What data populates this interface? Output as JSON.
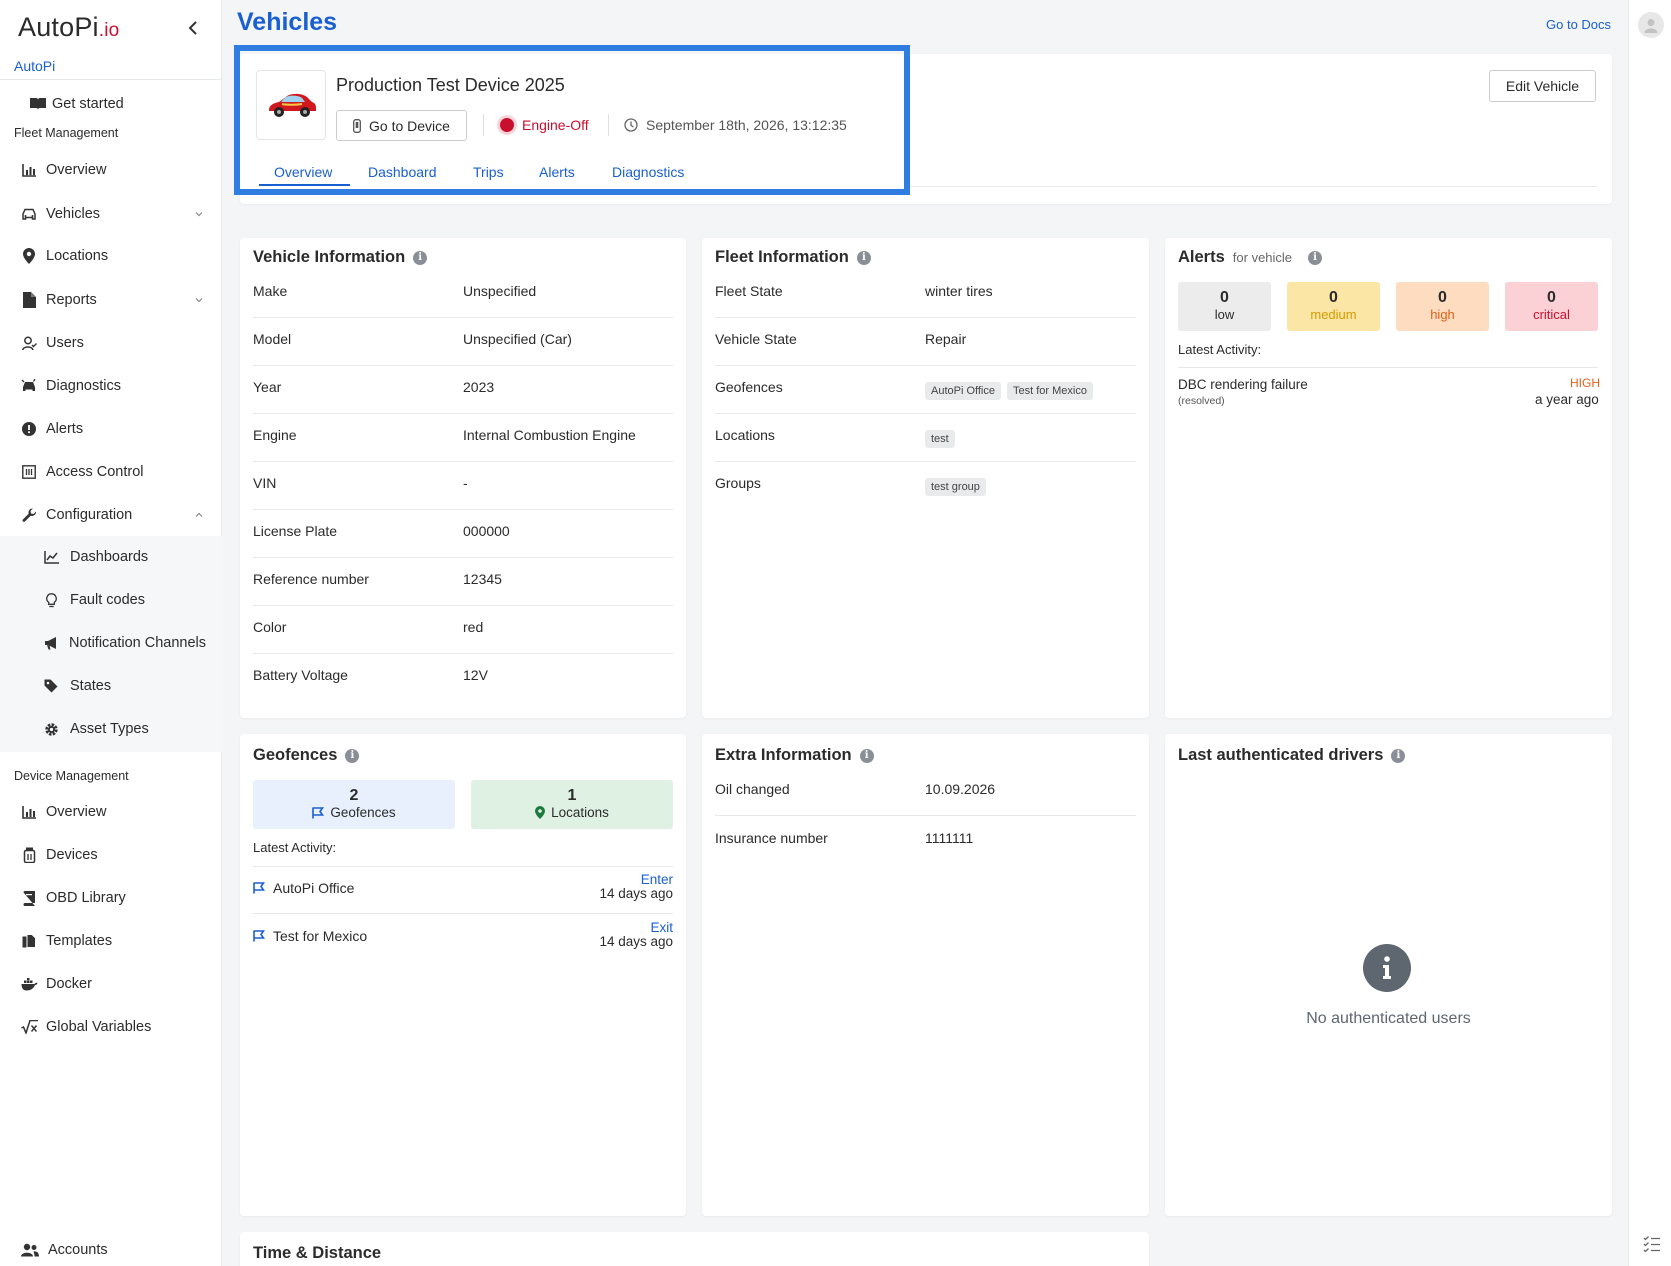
{
  "sidebar": {
    "logo_main": "AutoPi",
    "logo_suffix": ".io",
    "org": "AutoPi",
    "get_started": "Get started",
    "fleet_section": "Fleet Management",
    "fleet_items": [
      "Overview",
      "Vehicles",
      "Locations",
      "Reports",
      "Users",
      "Diagnostics",
      "Alerts",
      "Access Control",
      "Configuration"
    ],
    "config_items": [
      "Dashboards",
      "Fault codes",
      "Notification Channels",
      "States",
      "Asset Types"
    ],
    "device_section": "Device Management",
    "device_items": [
      "Overview",
      "Devices",
      "OBD Library",
      "Templates",
      "Docker",
      "Global Variables"
    ],
    "accounts": "Accounts"
  },
  "header": {
    "title": "Vehicles",
    "docs_link": "Go to Docs"
  },
  "vehicle": {
    "name": "Production Test Device 2025",
    "goto_device": "Go to Device",
    "engine_state": "Engine-Off",
    "timestamp": "September 18th, 2026, 13:12:35",
    "edit_button": "Edit Vehicle",
    "tabs": [
      "Overview",
      "Dashboard",
      "Trips",
      "Alerts",
      "Diagnostics"
    ],
    "active_tab": "Overview"
  },
  "vehicle_info": {
    "title": "Vehicle Information",
    "rows": [
      {
        "k": "Make",
        "v": "Unspecified"
      },
      {
        "k": "Model",
        "v": "Unspecified (Car)"
      },
      {
        "k": "Year",
        "v": "2023"
      },
      {
        "k": "Engine",
        "v": "Internal Combustion Engine"
      },
      {
        "k": "VIN",
        "v": "-"
      },
      {
        "k": "License Plate",
        "v": "000000"
      },
      {
        "k": "Reference number",
        "v": "12345"
      },
      {
        "k": "Color",
        "v": "red"
      },
      {
        "k": "Battery Voltage",
        "v": "12V"
      }
    ]
  },
  "fleet_info": {
    "title": "Fleet Information",
    "fleet_state_label": "Fleet State",
    "fleet_state": "winter tires",
    "vehicle_state_label": "Vehicle State",
    "vehicle_state": "Repair",
    "geofences_label": "Geofences",
    "geofences": [
      "AutoPi Office",
      "Test for Mexico"
    ],
    "locations_label": "Locations",
    "locations": [
      "test"
    ],
    "groups_label": "Groups",
    "groups": [
      "test group"
    ]
  },
  "alerts": {
    "title": "Alerts",
    "subtitle": "for vehicle",
    "counts": [
      {
        "n": "0",
        "t": "low",
        "bg": "#ececec",
        "fg": "#2b2b2b"
      },
      {
        "n": "0",
        "t": "medium",
        "bg": "#fbe6a5",
        "fg": "#d69a00"
      },
      {
        "n": "0",
        "t": "high",
        "bg": "#fddcc0",
        "fg": "#e0601a"
      },
      {
        "n": "0",
        "t": "critical",
        "bg": "#fbd1d6",
        "fg": "#c8102e"
      }
    ],
    "latest_label": "Latest Activity:",
    "activity": {
      "name": "DBC rendering failure",
      "status": "(resolved)",
      "level": "HIGH",
      "age": "a year ago"
    }
  },
  "geofences": {
    "title": "Geofences",
    "geofence_count": "2",
    "geofence_label": "Geofences",
    "location_count": "1",
    "location_label": "Locations",
    "latest_label": "Latest Activity:",
    "activity": [
      {
        "name": "AutoPi Office",
        "event": "Enter",
        "age": "14 days ago"
      },
      {
        "name": "Test for Mexico",
        "event": "Exit",
        "age": "14 days ago"
      }
    ]
  },
  "extra_info": {
    "title": "Extra Information",
    "rows": [
      {
        "k": "Oil changed",
        "v": "10.09.2026"
      },
      {
        "k": "Insurance number",
        "v": "1111111"
      }
    ]
  },
  "drivers": {
    "title": "Last authenticated drivers",
    "empty": "No authenticated users"
  },
  "time_distance": {
    "title": "Time & Distance"
  },
  "colors": {
    "accent": "#1a5fd0",
    "highlight": "#2f7de1",
    "engine_off": "#c8102e"
  }
}
